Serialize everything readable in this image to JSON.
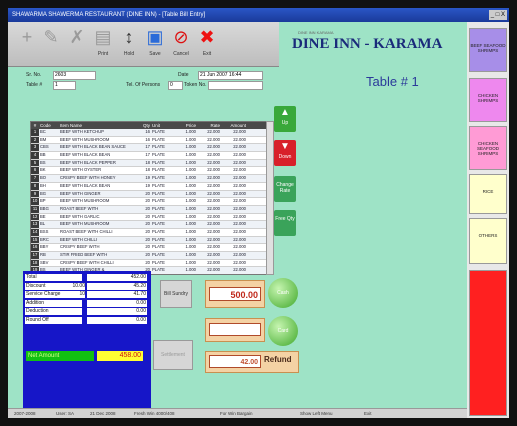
{
  "window": {
    "title": "SHAWARMA SHAWERMA RESTAURANT (DINE INN) - [Table Bill Entry]",
    "controls": "_ □ X"
  },
  "toolbar": [
    {
      "label": "",
      "icon": "plus-icon",
      "glyph": "+",
      "enabled": false
    },
    {
      "label": "",
      "icon": "pencil-icon",
      "glyph": "✎",
      "enabled": false
    },
    {
      "label": "",
      "icon": "delete-icon",
      "glyph": "✗",
      "enabled": false
    },
    {
      "label": "Print",
      "icon": "document-icon",
      "glyph": "▤",
      "enabled": false
    },
    {
      "label": "Hold",
      "icon": "hold-icon",
      "glyph": "↕",
      "enabled": true
    },
    {
      "label": "Save",
      "icon": "save-icon",
      "glyph": "▣",
      "enabled": true
    },
    {
      "label": "Cancel",
      "icon": "cancel-icon",
      "glyph": "⊘",
      "enabled": true
    },
    {
      "label": "Exit",
      "icon": "exit-icon",
      "glyph": "✖",
      "enabled": true
    }
  ],
  "header": {
    "outlet_small": "DINE INN KARAMA",
    "outlet": "DINE INN - KARAMA",
    "table_title": "Table # 1"
  },
  "form": {
    "sr_no_label": "Sr. No.",
    "sr_no": "2603",
    "table_label": "Table #",
    "table_value": "1",
    "date_label": "Date",
    "date_value": "21 Jun 2007 16:44",
    "tel_label": "Tel. Of Persons",
    "tel_value": "0",
    "token_label": "Token No.",
    "token_value": ""
  },
  "grid": {
    "columns": [
      "#",
      "Code",
      "Item Name",
      "Qty",
      "Unit",
      "Price",
      "Rate",
      "Amount"
    ],
    "rows": [
      [
        "1",
        "BC",
        "BEEF WITH KETCHUP",
        "16",
        "PLATE",
        "1.000",
        "22.000",
        "22.000"
      ],
      [
        "2",
        "BM",
        "BEEF WITH MUSHROOM",
        "16",
        "PLATE",
        "1.000",
        "22.000",
        "22.000"
      ],
      [
        "3",
        "CBS",
        "BEEF WITH BLACK BEAN SAUCE",
        "17",
        "PLATE",
        "1.000",
        "22.000",
        "22.000"
      ],
      [
        "4",
        "BB",
        "BEEF WITH BLACK BEAN",
        "17",
        "PLATE",
        "1.000",
        "22.000",
        "22.000"
      ],
      [
        "5",
        "BS",
        "BEEF WITH BLACK PEPPER",
        "18",
        "PLATE",
        "1.000",
        "22.000",
        "22.000"
      ],
      [
        "6",
        "BK",
        "BEEF WITH OYSTER",
        "18",
        "PLATE",
        "1.000",
        "22.000",
        "22.000"
      ],
      [
        "7",
        "BO",
        "CRISPY BEEF WITH HONEY",
        "19",
        "PLATE",
        "1.000",
        "22.000",
        "22.000"
      ],
      [
        "8",
        "BH",
        "BEEF WITH BLACK BEAN",
        "19",
        "PLATE",
        "1.000",
        "22.000",
        "22.000"
      ],
      [
        "9",
        "BG",
        "BEEF WITH GINGER",
        "20",
        "PLATE",
        "1.000",
        "22.000",
        "22.000"
      ],
      [
        "10",
        "BP",
        "BEEF WITH MUSHROOM",
        "20",
        "PLATE",
        "1.000",
        "22.000",
        "22.000"
      ],
      [
        "11",
        "BBG",
        "ROAST BEEF WITH",
        "20",
        "PLATE",
        "1.000",
        "22.000",
        "22.000"
      ],
      [
        "12",
        "BE",
        "BEEF WITH GARLIC",
        "20",
        "PLATE",
        "1.000",
        "22.000",
        "22.000"
      ],
      [
        "13",
        "BL",
        "BEEF WITH MUSHROOM",
        "20",
        "PLATE",
        "1.000",
        "22.000",
        "22.000"
      ],
      [
        "14",
        "BSS",
        "ROAST BEEF WITH CHILLI",
        "20",
        "PLATE",
        "1.000",
        "22.000",
        "22.000"
      ],
      [
        "15",
        "BRC",
        "BEEF WITH CHILLI",
        "20",
        "PLATE",
        "1.000",
        "22.000",
        "22.000"
      ],
      [
        "16",
        "BBY",
        "CRISPY BEEF WITH",
        "20",
        "PLATE",
        "1.000",
        "22.000",
        "22.000"
      ],
      [
        "17",
        "RB",
        "STIR FRIED BEEF WITH",
        "20",
        "PLATE",
        "1.000",
        "22.000",
        "22.000"
      ],
      [
        "18",
        "SBV",
        "CRISPY BEEF WITH CHILLI",
        "20",
        "PLATE",
        "1.000",
        "22.000",
        "22.000"
      ],
      [
        "19",
        "BS",
        "BEEF WITH GINGER &",
        "20",
        "PLATE",
        "1.000",
        "22.000",
        "22.000"
      ]
    ]
  },
  "side_buttons": [
    {
      "label": "Up",
      "icon": "arrow-up-icon",
      "glyph": "▲",
      "color": "#39a83a"
    },
    {
      "label": "Down",
      "icon": "arrow-down-icon",
      "glyph": "▼",
      "color": "#d8202a"
    },
    {
      "label": "Change Rate",
      "icon": "",
      "glyph": "",
      "color": "#3aa35a"
    },
    {
      "label": "Free Qty",
      "icon": "",
      "glyph": "",
      "color": "#3aa35a"
    }
  ],
  "totals": {
    "rows": [
      {
        "label": "Total",
        "pct": "",
        "value": "452.00"
      },
      {
        "label": "Discount",
        "pct": "10.00",
        "value": "45.20"
      },
      {
        "label": "Service Charge",
        "pct": "10",
        "value": "41.70"
      },
      {
        "label": "Addition",
        "pct": "",
        "value": "0.00"
      },
      {
        "label": "Deduction",
        "pct": "",
        "value": "0.00"
      },
      {
        "label": "Round Off",
        "pct": "",
        "value": "0.00"
      }
    ],
    "net_label": "Net Amount",
    "net_value": "458.00"
  },
  "actions": {
    "bill_sundry": "Bill Sundry",
    "settlement": "Settlement",
    "amount_received": "500.00",
    "blank_value": "",
    "refund_value": "42.00",
    "refund_label": "Refund",
    "cash_btn": "Cash",
    "card_btn": "Card"
  },
  "categories": [
    {
      "label": "BEEF SEAFOOD SHRIMPS",
      "color": "#a78ee8"
    },
    {
      "label": "CHICKEN SHRIMPS",
      "color": "#ee88ee"
    },
    {
      "label": "CHICKEN SEAFOOD SHRIMPS",
      "color": "#ff9bd5"
    },
    {
      "label": "RICE",
      "color": "#ffffcc"
    },
    {
      "label": "OTHERS",
      "color": "#ffffcc"
    },
    {
      "label": "",
      "color": "#ff2020"
    }
  ],
  "status": [
    "2007-2008",
    "User: SA",
    "21 Dec 2008",
    "Fresh Win 4000/408",
    "For Win Bargain",
    "Show Left Menu",
    "Exit"
  ]
}
